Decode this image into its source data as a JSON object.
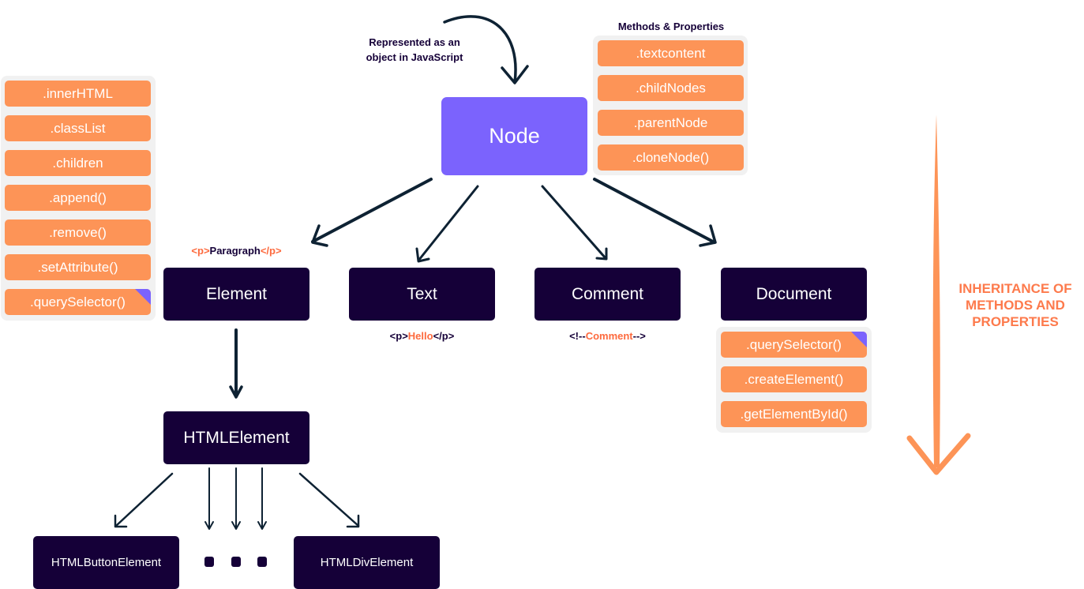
{
  "root": {
    "label": "Node",
    "annotation_line1": "Represented as an",
    "annotation_line2": "object in JavaScript",
    "methods_title": "Methods & Properties",
    "methods": [
      ".textcontent",
      ".childNodes",
      ".parentNode",
      ".cloneNode()"
    ]
  },
  "element_methods": [
    ".innerHTML",
    ".classList",
    ".children",
    ".append()",
    ".remove()",
    ".setAttribute()",
    ".querySelector()"
  ],
  "children": [
    {
      "label": "Element",
      "example_prefix": "<p>",
      "example_content": "Paragraph",
      "example_suffix": "</p>"
    },
    {
      "label": "Text",
      "example_prefix": "<p>",
      "example_content": "Hello",
      "example_suffix": "</p>"
    },
    {
      "label": "Comment",
      "example_prefix": "<!--",
      "example_content": "Comment",
      "example_suffix": "-->"
    },
    {
      "label": "Document"
    }
  ],
  "document_methods": [
    ".querySelector()",
    ".createElement()",
    ".getElementById()"
  ],
  "html_element": {
    "label": "HTMLElement"
  },
  "html_subclasses": [
    "HTMLButtonElement",
    "HTMLDivElement"
  ],
  "inheritance_label": [
    "INHERITANCE OF",
    "METHODS AND",
    "PROPERTIES"
  ],
  "colors": {
    "orange": "#fd9457",
    "purple": "#7b63fd",
    "dark": "#150038",
    "accent_text": "#fd6a3e"
  }
}
